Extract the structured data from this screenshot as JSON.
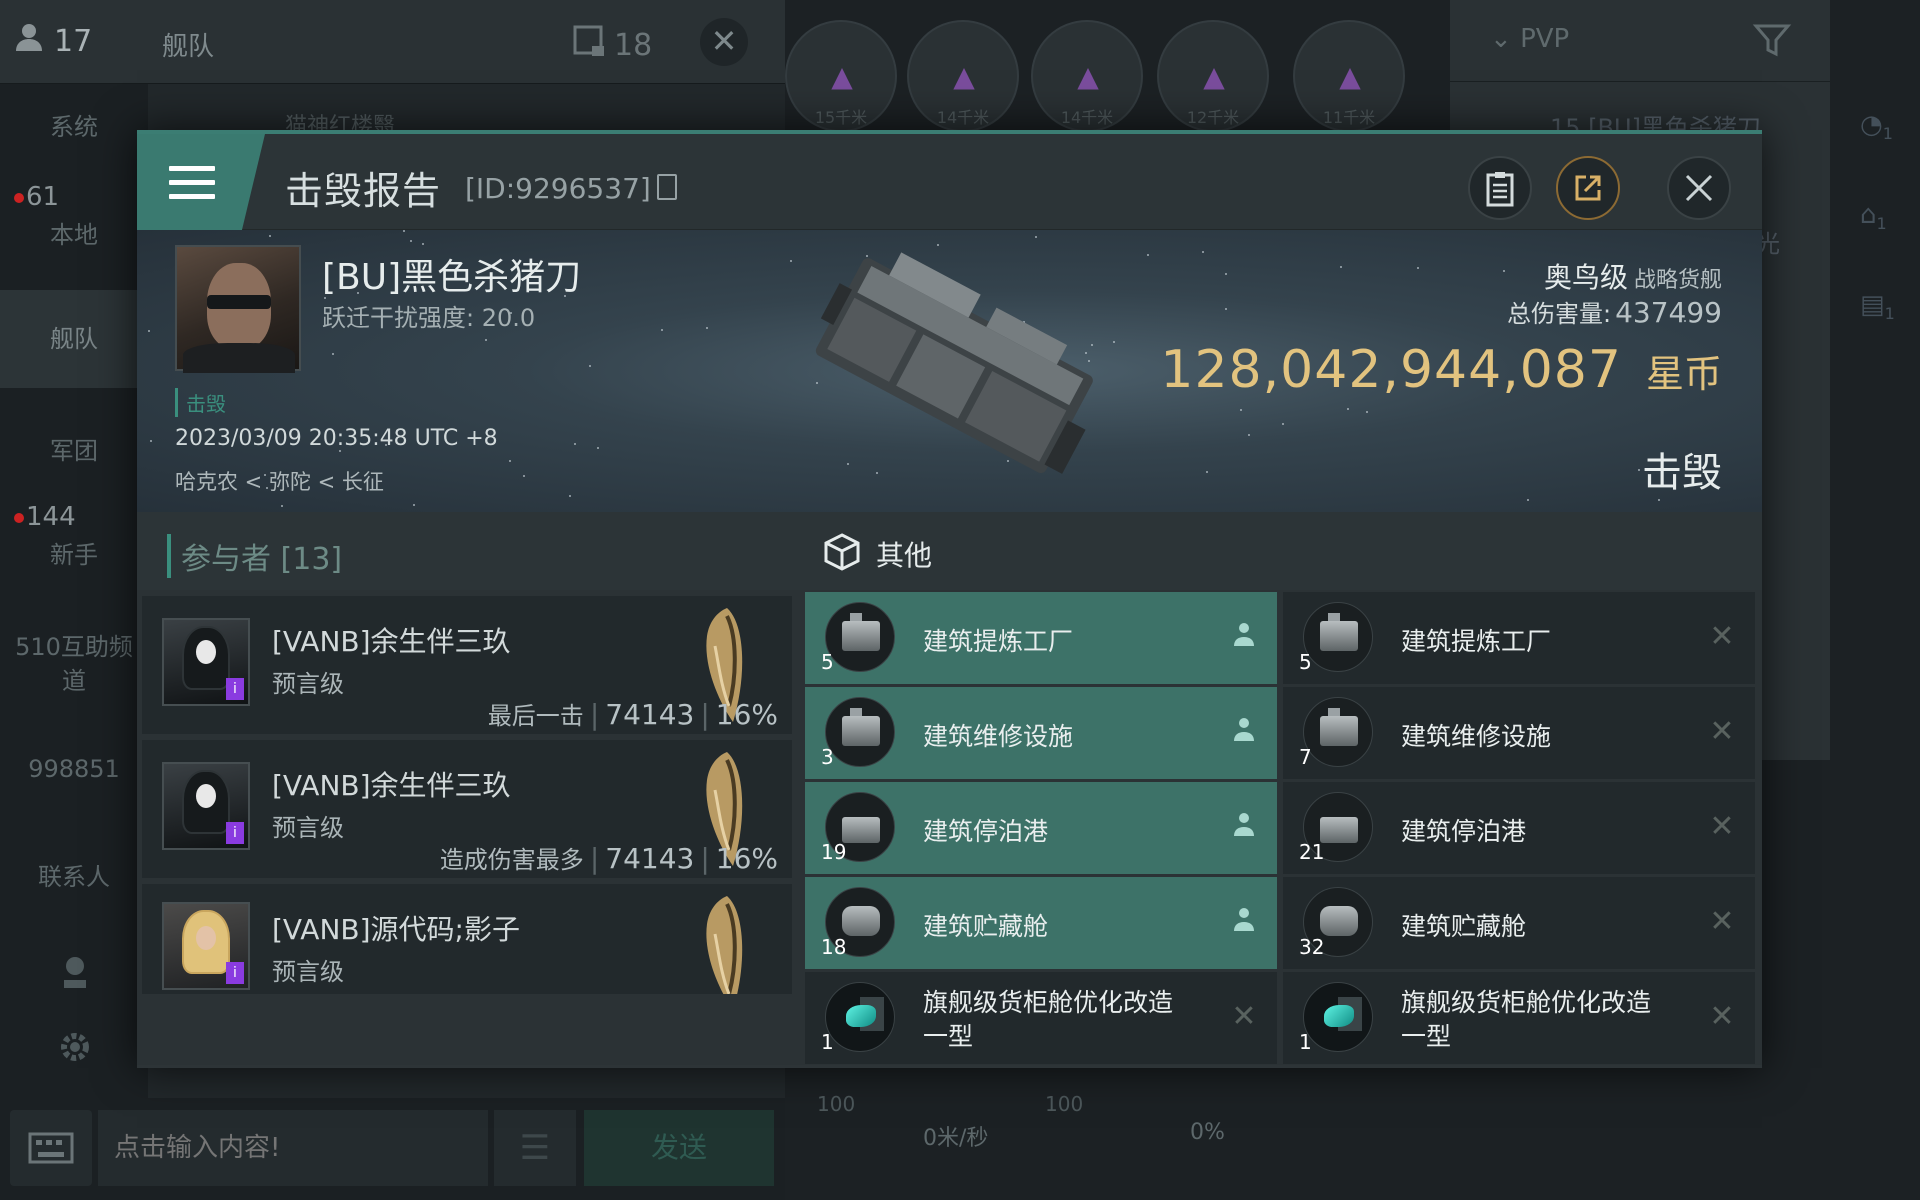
{
  "background": {
    "chat": {
      "member_count": "17",
      "title": "舰队",
      "unread_count": "18",
      "close_glyph": "✕",
      "message_preview": "猫神红楼翳",
      "side_nav": [
        {
          "label": "系统",
          "badge": ""
        },
        {
          "label": "本地",
          "badge": "61"
        },
        {
          "label": "舰队",
          "badge": ""
        },
        {
          "label": "军团",
          "badge": ""
        },
        {
          "label": "新手",
          "badge": "144"
        },
        {
          "label": "510互助频道",
          "badge": ""
        },
        {
          "label": "998851",
          "badge": ""
        },
        {
          "label": "联系人",
          "badge": ""
        }
      ],
      "input_placeholder": "点击输入内容!",
      "send_label": "发送",
      "menu_glyph": "☰"
    },
    "overview_targets": [
      {
        "distance": "15千米"
      },
      {
        "distance": "14千米"
      },
      {
        "distance": "14千米"
      },
      {
        "distance": "12千米"
      },
      {
        "distance": "11千米"
      }
    ],
    "right_panel": {
      "filter_label": "PVP",
      "row_text": "15 [BU]黑色杀猪刀",
      "side_letter": "光",
      "icon_counts": [
        "1",
        "1",
        "1"
      ]
    },
    "hud": {
      "speed": "0米/秒",
      "percent": "0%",
      "left_val": "100",
      "right_val": "100"
    }
  },
  "modal": {
    "title": "击毁报告",
    "kill_id": "[ID:9296537]",
    "victim": {
      "name": "[BU]黑色杀猪刀",
      "warp_disruption": "跃迁干扰强度: 20.0",
      "status_tag": "击毁",
      "datetime": "2023/03/09 20:35:48 UTC +8",
      "location": "哈克农 < 弥陀 < 长征"
    },
    "ship": {
      "class": "奥鸟级",
      "type": "战略货舰",
      "total_damage_label": "总伤害量:",
      "total_damage": "437499",
      "isk_value": "128,042,944,087",
      "isk_unit": "星币",
      "result": "击毁"
    },
    "participants": {
      "header": "参与者 [13]",
      "rows": [
        {
          "name": "[VANB]余生伴三玖",
          "ship": "预言级",
          "tag": "最后一击",
          "damage": "74143",
          "percent": "16%",
          "avatar": "hood"
        },
        {
          "name": "[VANB]余生伴三玖",
          "ship": "预言级",
          "tag": "造成伤害最多",
          "damage": "74143",
          "percent": "16%",
          "avatar": "hood"
        },
        {
          "name": "[VANB]源代码;影子",
          "ship": "预言级",
          "tag": "",
          "damage": "",
          "percent": "",
          "avatar": "blonde"
        }
      ]
    },
    "items": {
      "header": "其他",
      "dropped": [
        {
          "name": "建筑提炼工厂",
          "qty": "5",
          "icon": "structure-refinery-icon"
        },
        {
          "name": "建筑维修设施",
          "qty": "3",
          "icon": "structure-repair-icon"
        },
        {
          "name": "建筑停泊港",
          "qty": "19",
          "icon": "structure-dock-icon"
        },
        {
          "name": "建筑贮藏舱",
          "qty": "18",
          "icon": "structure-storage-icon"
        },
        {
          "name": "旗舰级货柜舱优化改造\n一型",
          "qty": "1",
          "icon": "rig-module-icon"
        }
      ],
      "destroyed": [
        {
          "name": "建筑提炼工厂",
          "qty": "5",
          "icon": "structure-refinery-icon"
        },
        {
          "name": "建筑维修设施",
          "qty": "7",
          "icon": "structure-repair-icon"
        },
        {
          "name": "建筑停泊港",
          "qty": "21",
          "icon": "structure-dock-icon"
        },
        {
          "name": "建筑贮藏舱",
          "qty": "32",
          "icon": "structure-storage-icon"
        },
        {
          "name": "旗舰级货柜舱优化改造\n一型",
          "qty": "1",
          "icon": "rig-module-icon"
        }
      ],
      "dropped_flag_icon": "person-icon",
      "destroyed_flag_icon": "x-mark-icon"
    }
  },
  "colors": {
    "accent": "#3a7a70",
    "isk_gold": "#e2c37f",
    "dropped_bg": "#3d7268"
  }
}
